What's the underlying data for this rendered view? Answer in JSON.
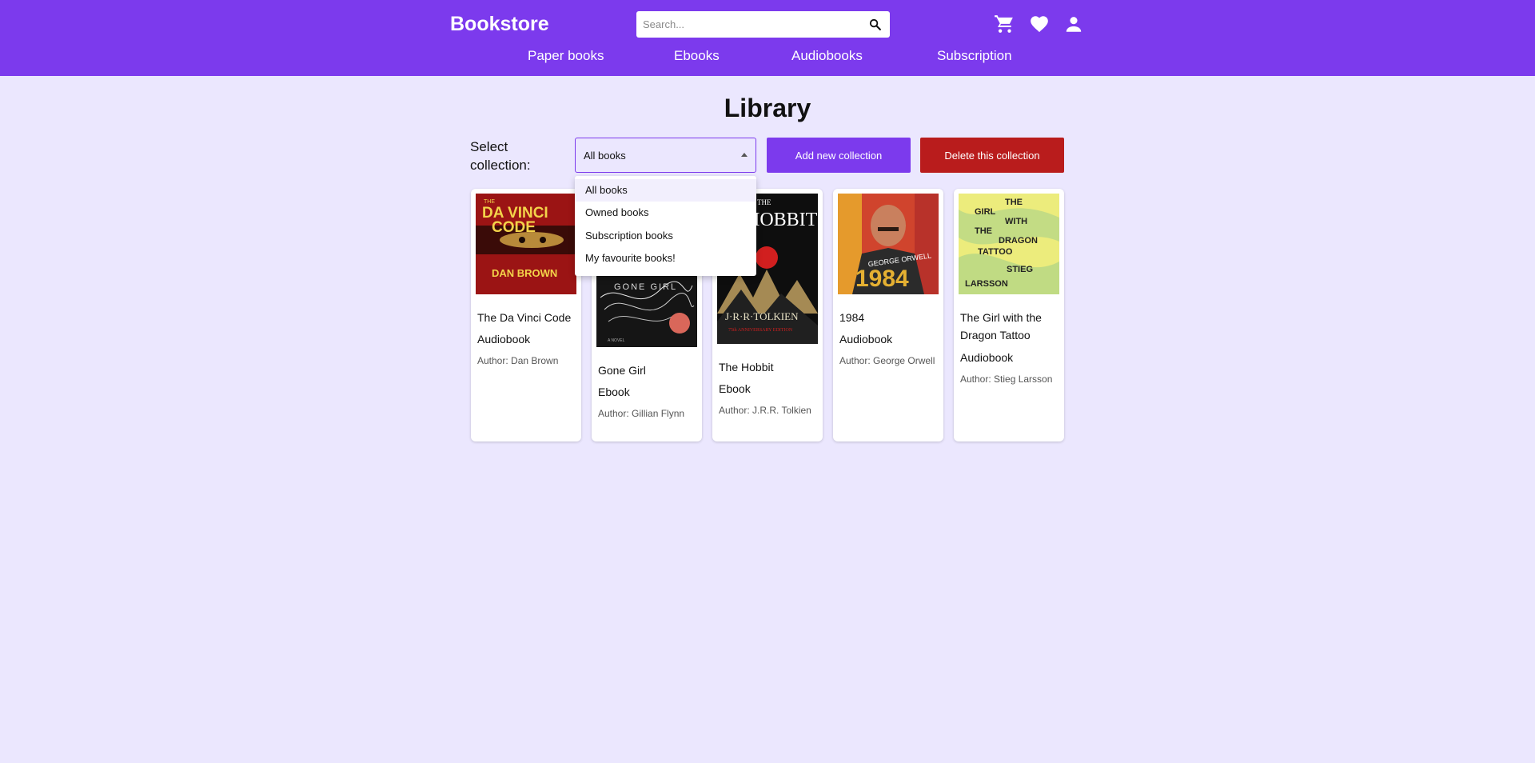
{
  "header": {
    "brand": "Bookstore",
    "search_placeholder": "Search...",
    "icons": [
      "search-icon",
      "cart-icon",
      "heart-icon",
      "user-icon"
    ],
    "nav": [
      "Paper books",
      "Ebooks",
      "Audiobooks",
      "Subscription"
    ],
    "accent_color": "#7c3aed"
  },
  "main": {
    "title": "Library",
    "select_label": "Select collection:",
    "selected_collection": "All books",
    "add_button": "Add new collection",
    "delete_button": "Delete this collection",
    "delete_color": "#b91c1c",
    "collection_options": [
      "All books",
      "Owned books",
      "Subscription books",
      "My favourite books!"
    ],
    "books": [
      {
        "title": "The Da Vinci Code",
        "type": "Audiobook",
        "author": "Author: Dan Brown",
        "cover_text": [
          "THE",
          "DA VINCI",
          "CODE",
          "DAN BROWN"
        ]
      },
      {
        "title": "Gone Girl",
        "type": "Ebook",
        "author": "Author: Gillian Flynn",
        "cover_text": [
          "GONE GIRL",
          "A NOVEL"
        ]
      },
      {
        "title": "The Hobbit",
        "type": "Ebook",
        "author": "Author: J.R.R. Tolkien",
        "cover_text": [
          "THE",
          "HOBBIT",
          "J·R·R·TOLKIEN",
          "75th ANNIVERSARY EDITION"
        ]
      },
      {
        "title": "1984",
        "type": "Audiobook",
        "author": "Author: George Orwell",
        "cover_text": [
          "GEORGE ORWELL",
          "1984"
        ]
      },
      {
        "title": "The Girl with the Dragon Tattoo",
        "type": "Audiobook",
        "author": "Author: Stieg Larsson",
        "cover_text": [
          "THE",
          "GIRL",
          "WITH",
          "THE",
          "DRAGON",
          "TATTOO",
          "STIEG",
          "LARSSON"
        ]
      }
    ]
  }
}
